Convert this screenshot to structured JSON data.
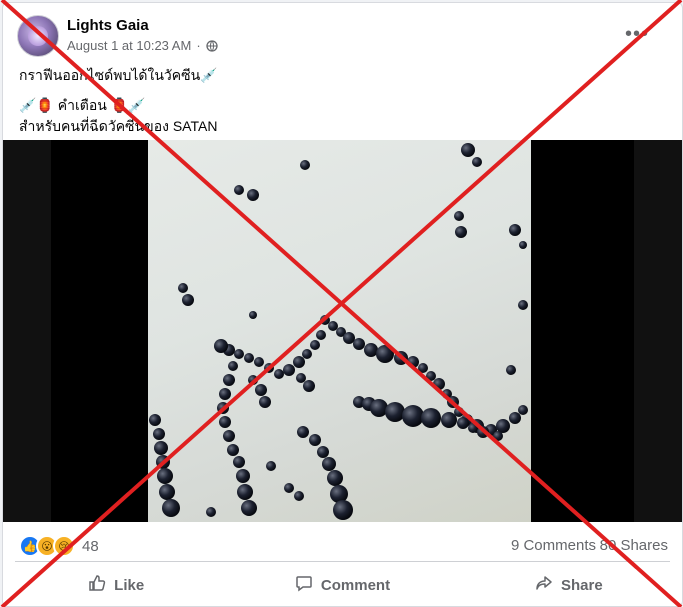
{
  "post": {
    "author": "Lights Gaia",
    "timestamp": "August 1 at 10:23 AM",
    "dot": "·",
    "privacy_icon": "globe-icon",
    "more_icon": "more-options-icon",
    "text_line1": "กราฟีนออกไซด์พบได้ในวัคซีน💉",
    "text_line2": "💉🏮 คำเตือน 🏮💉",
    "text_line3": "สำหรับคนที่ฉีดวัคซีนของ SATAN"
  },
  "stats": {
    "reaction_icons": [
      "like-icon",
      "wow-icon",
      "sad-icon"
    ],
    "reaction_count": "48",
    "comments": "9 Comments",
    "shares": "80 Shares"
  },
  "actions": {
    "like": "Like",
    "comment": "Comment",
    "share": "Share"
  },
  "overlay": {
    "x_color": "#e02020"
  }
}
